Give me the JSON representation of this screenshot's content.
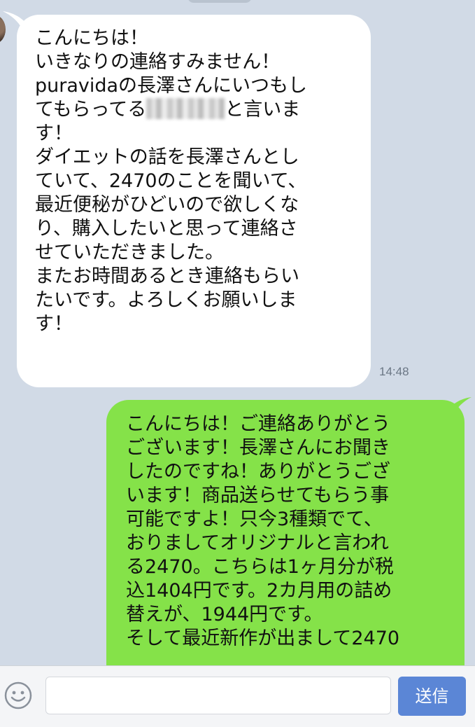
{
  "messages": {
    "received": {
      "lines_before_name": "こんにちは！\nいきなりの連絡すみません！\npuravidaの長澤さんにいつもし\nてもらってる",
      "lines_after_name": "と言いま\nす！\nダイエットの話を長澤さんとし\nていて、2470のことを聞いて、\n最近便秘がひどいので欲しくな\nり、購入したいと思って連絡さ\nせていただきました。\nまたお時間あるとき連絡もらい\nたいです。よろしくお願いしま\nす！",
      "time": "14:48"
    },
    "sent": {
      "text": "こんにちは！ご連絡ありがとう\nございます！長澤さんにお聞き\nしたのですね！ありがとうござ\nいます！商品送らせてもらう事\n可能ですよ！只今3種類でて、\nおりましてオリジナルと言われ\nる2470。こちらは1ヶ月分が税\n込1404円です。2カ月用の詰め\n替えが、1944円です。\nそして最近新作が出まして2470"
    }
  },
  "input_bar": {
    "emoji_icon": "smiley-icon",
    "input_value": "",
    "input_placeholder": "",
    "send_label": "送信"
  },
  "colors": {
    "background": "#d1dae6",
    "received_bubble": "#ffffff",
    "sent_bubble": "#85e249",
    "send_button": "#5b86d6"
  }
}
